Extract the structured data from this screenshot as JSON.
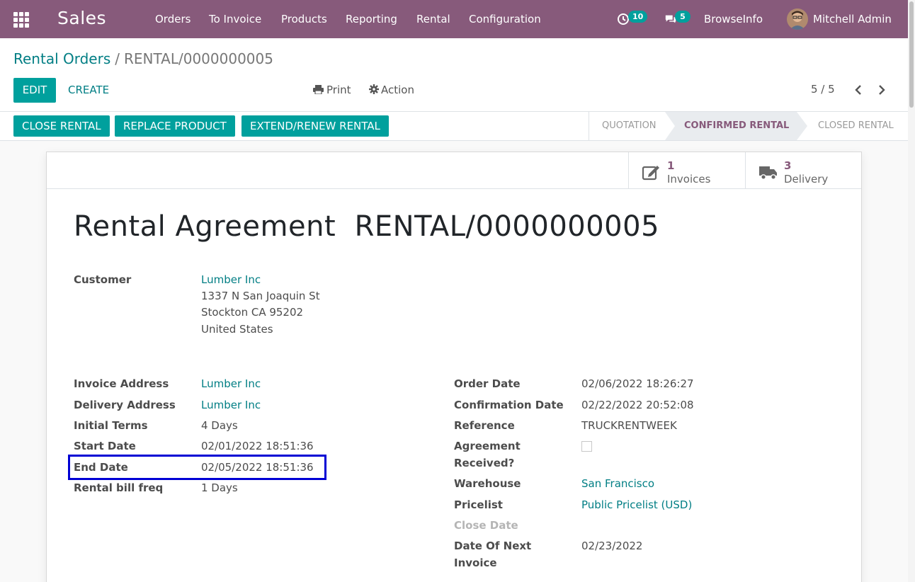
{
  "navbar": {
    "app_name": "Sales",
    "menu": [
      "Orders",
      "To Invoice",
      "Products",
      "Reporting",
      "Rental",
      "Configuration"
    ],
    "activity_count": "10",
    "message_count": "5",
    "company": "BrowseInfo",
    "user": "Mitchell Admin"
  },
  "breadcrumb": {
    "parent": "Rental Orders",
    "separator": "/",
    "current": "RENTAL/0000000005"
  },
  "toolbar": {
    "edit_label": "EDIT",
    "create_label": "CREATE",
    "print_label": "Print",
    "action_label": "Action",
    "pager": "5 / 5"
  },
  "statusbar": {
    "buttons": [
      "CLOSE RENTAL",
      "REPLACE PRODUCT",
      "EXTEND/RENEW RENTAL"
    ],
    "stages": [
      "QUOTATION",
      "CONFIRMED RENTAL",
      "CLOSED RENTAL"
    ],
    "active_stage": "CONFIRMED RENTAL"
  },
  "smart_buttons": [
    {
      "value": "1",
      "label": "Invoices",
      "icon": "pencil-square-icon"
    },
    {
      "value": "3",
      "label": "Delivery",
      "icon": "truck-icon"
    }
  ],
  "form": {
    "title_prefix": "Rental Agreement",
    "title_name": "RENTAL/0000000005",
    "customer": {
      "label": "Customer",
      "name": "Lumber Inc",
      "address": [
        "1337 N San Joaquin St",
        "Stockton CA 95202",
        "United States"
      ]
    },
    "left_fields": [
      {
        "label": "Invoice Address",
        "value": "Lumber Inc",
        "link": true
      },
      {
        "label": "Delivery Address",
        "value": "Lumber Inc",
        "link": true
      },
      {
        "label": "Initial Terms",
        "value": "4 Days",
        "link": false
      },
      {
        "label": "Start Date",
        "value": "02/01/2022 18:51:36",
        "link": false
      },
      {
        "label": "End Date",
        "value": "02/05/2022 18:51:36",
        "link": false
      },
      {
        "label": "Rental bill freq",
        "value": "1 Days",
        "link": false
      }
    ],
    "right_fields": {
      "order_date": {
        "label": "Order Date",
        "value": "02/06/2022 18:26:27"
      },
      "confirmation_date": {
        "label": "Confirmation Date",
        "value": "02/22/2022 20:52:08"
      },
      "reference": {
        "label": "Reference",
        "value": "TRUCKRENTWEEK"
      },
      "agreement_received": {
        "label_line1": "Agreement",
        "label_line2": "Received?",
        "checked": false
      },
      "warehouse": {
        "label": "Warehouse",
        "value": "San Francisco"
      },
      "pricelist": {
        "label": "Pricelist",
        "value": "Public Pricelist (USD)"
      },
      "close_date": {
        "label": "Close Date",
        "value": ""
      },
      "next_invoice": {
        "label_line1": "Date Of Next",
        "label_line2": "Invoice",
        "value": "02/23/2022"
      }
    }
  },
  "colors": {
    "navbar": "#875a7b",
    "primary": "#00a09d",
    "link": "#017e84",
    "highlight_box": "#0000d4"
  }
}
